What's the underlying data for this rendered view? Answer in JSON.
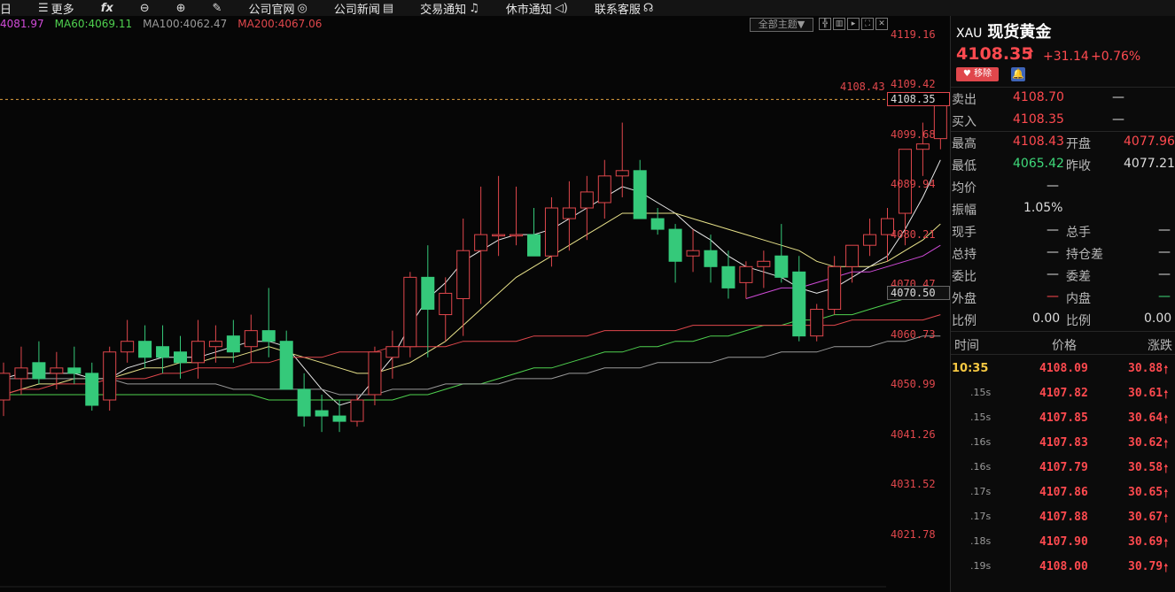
{
  "toolbar": {
    "items": [
      {
        "label": "日",
        "icon": ""
      },
      {
        "label": "更多",
        "icon": "menu-icon"
      },
      {
        "label": "",
        "icon": "fx-icon"
      },
      {
        "label": "",
        "icon": "zoom-out-icon"
      },
      {
        "label": "",
        "icon": "zoom-in-icon"
      },
      {
        "label": "",
        "icon": "draw-icon"
      },
      {
        "label": "公司官网",
        "icon": "globe-icon"
      },
      {
        "label": "公司新闻",
        "icon": "news-icon"
      },
      {
        "label": "交易通知",
        "icon": "bell-icon"
      },
      {
        "label": "休市通知",
        "icon": "speaker-icon"
      },
      {
        "label": "联系客服",
        "icon": "headset-icon"
      }
    ]
  },
  "ma_legend": [
    {
      "label": "4081.97",
      "color": "#d04bd8"
    },
    {
      "label": "MA60:4069.11",
      "color": "#4fd14f"
    },
    {
      "label": "MA100:4062.47",
      "color": "#9a9a9a"
    },
    {
      "label": "MA200:4067.06",
      "color": "#e0474c"
    }
  ],
  "theme_button": "全部主题▼",
  "axis": {
    "ticks": [
      "4119.16",
      "4109.42",
      "4099.68",
      "4089.94",
      "4080.21",
      "4070.47",
      "4060.73",
      "4050.99",
      "4041.26",
      "4031.52",
      "4021.78"
    ],
    "current_price": "4108.35",
    "aux_price": "4070.50",
    "high_label": "4108.43"
  },
  "chart_data": {
    "type": "candlestick",
    "ylim": [
      4016,
      4124
    ],
    "candles": [
      {
        "o": 4052,
        "h": 4059,
        "l": 4049,
        "c": 4057
      },
      {
        "o": 4056,
        "h": 4062,
        "l": 4053,
        "c": 4058
      },
      {
        "o": 4059,
        "h": 4063,
        "l": 4055,
        "c": 4056
      },
      {
        "o": 4057,
        "h": 4061,
        "l": 4054,
        "c": 4058
      },
      {
        "o": 4058,
        "h": 4062,
        "l": 4055,
        "c": 4057
      },
      {
        "o": 4057,
        "h": 4059,
        "l": 4050,
        "c": 4051
      },
      {
        "o": 4052,
        "h": 4062,
        "l": 4050,
        "c": 4061
      },
      {
        "o": 4061,
        "h": 4067,
        "l": 4059,
        "c": 4063
      },
      {
        "o": 4063,
        "h": 4066,
        "l": 4058,
        "c": 4060
      },
      {
        "o": 4062,
        "h": 4066,
        "l": 4057,
        "c": 4060
      },
      {
        "o": 4061,
        "h": 4064,
        "l": 4056,
        "c": 4059
      },
      {
        "o": 4059,
        "h": 4067,
        "l": 4056,
        "c": 4063
      },
      {
        "o": 4062,
        "h": 4066,
        "l": 4059,
        "c": 4063
      },
      {
        "o": 4064,
        "h": 4067,
        "l": 4059,
        "c": 4061
      },
      {
        "o": 4062,
        "h": 4068,
        "l": 4059,
        "c": 4065
      },
      {
        "o": 4065,
        "h": 4073,
        "l": 4060,
        "c": 4063
      },
      {
        "o": 4063,
        "h": 4065,
        "l": 4054,
        "c": 4054
      },
      {
        "o": 4054,
        "h": 4057,
        "l": 4047,
        "c": 4049
      },
      {
        "o": 4050,
        "h": 4053,
        "l": 4046,
        "c": 4049
      },
      {
        "o": 4049,
        "h": 4052,
        "l": 4046,
        "c": 4048
      },
      {
        "o": 4048,
        "h": 4053,
        "l": 4047,
        "c": 4052
      },
      {
        "o": 4053,
        "h": 4062,
        "l": 4051,
        "c": 4061
      },
      {
        "o": 4060,
        "h": 4065,
        "l": 4056,
        "c": 4062
      },
      {
        "o": 4062,
        "h": 4076,
        "l": 4060,
        "c": 4075
      },
      {
        "o": 4075,
        "h": 4081,
        "l": 4060,
        "c": 4069
      },
      {
        "o": 4068,
        "h": 4075,
        "l": 4063,
        "c": 4072
      },
      {
        "o": 4071,
        "h": 4086,
        "l": 4064,
        "c": 4080
      },
      {
        "o": 4080,
        "h": 4092,
        "l": 4070,
        "c": 4083
      },
      {
        "o": 4083,
        "h": 4094,
        "l": 4079,
        "c": 4083
      },
      {
        "o": 4083,
        "h": 4092,
        "l": 4081,
        "c": 4083
      },
      {
        "o": 4083,
        "h": 4088,
        "l": 4080,
        "c": 4079
      },
      {
        "o": 4079,
        "h": 4090,
        "l": 4077,
        "c": 4088
      },
      {
        "o": 4086,
        "h": 4093,
        "l": 4080,
        "c": 4088
      },
      {
        "o": 4088,
        "h": 4094,
        "l": 4082,
        "c": 4091
      },
      {
        "o": 4089,
        "h": 4097,
        "l": 4086,
        "c": 4094
      },
      {
        "o": 4094,
        "h": 4104,
        "l": 4090,
        "c": 4095
      },
      {
        "o": 4095,
        "h": 4097,
        "l": 4089,
        "c": 4086
      },
      {
        "o": 4086,
        "h": 4088,
        "l": 4083,
        "c": 4084
      },
      {
        "o": 4084,
        "h": 4085,
        "l": 4074,
        "c": 4078
      },
      {
        "o": 4079,
        "h": 4084,
        "l": 4076,
        "c": 4080
      },
      {
        "o": 4080,
        "h": 4083,
        "l": 4074,
        "c": 4077
      },
      {
        "o": 4077,
        "h": 4080,
        "l": 4071,
        "c": 4073
      },
      {
        "o": 4074,
        "h": 4078,
        "l": 4071,
        "c": 4077
      },
      {
        "o": 4077,
        "h": 4080,
        "l": 4073,
        "c": 4078
      },
      {
        "o": 4079,
        "h": 4085,
        "l": 4074,
        "c": 4075
      },
      {
        "o": 4076,
        "h": 4079,
        "l": 4063,
        "c": 4064
      },
      {
        "o": 4064,
        "h": 4070,
        "l": 4063,
        "c": 4069
      },
      {
        "o": 4069,
        "h": 4079,
        "l": 4068,
        "c": 4077
      },
      {
        "o": 4077,
        "h": 4081,
        "l": 4074,
        "c": 4081
      },
      {
        "o": 4081,
        "h": 4086,
        "l": 4079,
        "c": 4083
      },
      {
        "o": 4083,
        "h": 4088,
        "l": 4078,
        "c": 4086
      },
      {
        "o": 4087,
        "h": 4099,
        "l": 4081,
        "c": 4099
      },
      {
        "o": 4099,
        "h": 4104,
        "l": 4094,
        "c": 4100
      },
      {
        "o": 4101,
        "h": 4109,
        "l": 4099,
        "c": 4108
      }
    ],
    "ma_lines": [
      {
        "name": "MA-white",
        "color": "#e8e8e8",
        "values": [
          4056,
          4057,
          4057,
          4057,
          4057,
          4056,
          4056,
          4058,
          4059,
          4060,
          4060,
          4060,
          4061,
          4062,
          4063,
          4063,
          4062,
          4058,
          4054,
          4051,
          4052,
          4056,
          4060,
          4066,
          4071,
          4074,
          4078,
          4080,
          4082,
          4083,
          4083,
          4084,
          4086,
          4088,
          4090,
          4092,
          4091,
          4089,
          4087,
          4084,
          4082,
          4079,
          4077,
          4076,
          4075,
          4073,
          4072,
          4073,
          4075,
          4077,
          4079,
          4084,
          4090,
          4097
        ]
      },
      {
        "name": "MA-yellow",
        "color": "#e8e28a",
        "values": [
          4053,
          4054,
          4055,
          4055,
          4056,
          4056,
          4056,
          4057,
          4058,
          4058,
          4059,
          4059,
          4060,
          4060,
          4061,
          4062,
          4061,
          4060,
          4059,
          4058,
          4057,
          4057,
          4058,
          4059,
          4061,
          4063,
          4066,
          4069,
          4072,
          4075,
          4077,
          4079,
          4081,
          4083,
          4085,
          4087,
          4087,
          4087,
          4087,
          4086,
          4085,
          4084,
          4083,
          4082,
          4081,
          4080,
          4078,
          4077,
          4077,
          4077,
          4078,
          4080,
          4082,
          4085
        ]
      },
      {
        "name": "MA-magenta",
        "color": "#d04bd8",
        "values": [
          null,
          null,
          null,
          null,
          null,
          null,
          null,
          null,
          null,
          null,
          null,
          null,
          null,
          null,
          null,
          null,
          null,
          null,
          null,
          null,
          null,
          null,
          null,
          null,
          null,
          null,
          null,
          null,
          null,
          null,
          null,
          null,
          null,
          null,
          null,
          null,
          null,
          null,
          null,
          null,
          null,
          null,
          4071,
          4072,
          4073,
          4073,
          4074,
          4075,
          4076,
          4076,
          4077,
          4078,
          4079,
          4081
        ]
      },
      {
        "name": "MA60",
        "color": "#4fd14f",
        "values": [
          4053,
          4053,
          4053,
          4053,
          4053,
          4053,
          4053,
          4053,
          4053,
          4053,
          4053,
          4053,
          4053,
          4053,
          4053,
          4052,
          4052,
          4052,
          4052,
          4052,
          4052,
          4052,
          4052,
          4053,
          4053,
          4054,
          4055,
          4055,
          4056,
          4057,
          4058,
          4058,
          4059,
          4060,
          4061,
          4061,
          4062,
          4062,
          4063,
          4063,
          4064,
          4064,
          4065,
          4066,
          4066,
          4067,
          4067,
          4068,
          4068,
          4069,
          4070,
          4071,
          4072,
          4073
        ]
      },
      {
        "name": "MA100",
        "color": "#9a9a9a",
        "values": [
          4056,
          4056,
          4056,
          4056,
          4056,
          4056,
          4056,
          4055,
          4055,
          4055,
          4055,
          4055,
          4055,
          4054,
          4054,
          4054,
          4054,
          4054,
          4054,
          4053,
          4053,
          4053,
          4054,
          4054,
          4054,
          4055,
          4055,
          4055,
          4055,
          4056,
          4056,
          4056,
          4057,
          4057,
          4058,
          4058,
          4058,
          4059,
          4059,
          4059,
          4059,
          4060,
          4060,
          4060,
          4061,
          4061,
          4061,
          4062,
          4062,
          4062,
          4063,
          4063,
          4064,
          4064
        ]
      },
      {
        "name": "MA200",
        "color": "#e0474c",
        "values": [
          4053,
          4054,
          4054,
          4055,
          4055,
          4055,
          4056,
          4056,
          4056,
          4057,
          4057,
          4058,
          4058,
          4058,
          4059,
          4059,
          4060,
          4060,
          4060,
          4061,
          4061,
          4061,
          4062,
          4062,
          4062,
          4062,
          4063,
          4063,
          4063,
          4063,
          4064,
          4064,
          4064,
          4064,
          4065,
          4065,
          4065,
          4065,
          4065,
          4066,
          4066,
          4066,
          4066,
          4066,
          4066,
          4066,
          4066,
          4066,
          4067,
          4067,
          4067,
          4067,
          4067,
          4068
        ]
      }
    ]
  },
  "quote": {
    "code": "XAU",
    "name": "现货黄金",
    "last": "4108.35",
    "change": "+31.14",
    "change_pct": "+0.76%",
    "remove_label": "移除",
    "sell_label": "卖出",
    "sell": "4108.70",
    "sell_vol": "—",
    "buy_label": "买入",
    "buy": "4108.35",
    "buy_vol": "—",
    "high_label": "最高",
    "high": "4108.43",
    "open_label": "开盘",
    "open": "4077.96",
    "low_label": "最低",
    "low": "4065.42",
    "prev_label": "昨收",
    "prev": "4077.21",
    "avg_label": "均价",
    "avg": "—",
    "amp_label": "振幅",
    "amp": "1.05%",
    "now_hand_label": "现手",
    "now_hand": "—",
    "total_hand_label": "总手",
    "total_hand": "—",
    "total_hold_label": "总持",
    "total_hold": "—",
    "hold_diff_label": "持仓差",
    "hold_diff": "—",
    "bid_ratio_label": "委比",
    "bid_ratio": "—",
    "bid_diff_label": "委差",
    "bid_diff": "—",
    "outer_label": "外盘",
    "outer": "—",
    "inner_label": "内盘",
    "inner": "—",
    "ratio1_label": "比例",
    "ratio1": "0.00",
    "ratio2_label": "比例",
    "ratio2": "0.00"
  },
  "ticks": {
    "headers": [
      "时间",
      "价格",
      "涨跌"
    ],
    "rows": [
      {
        "time": "10:35",
        "price": "4108.09",
        "chg": "30.88"
      },
      {
        "time": ".15s",
        "price": "4107.82",
        "chg": "30.61"
      },
      {
        "time": ".15s",
        "price": "4107.85",
        "chg": "30.64"
      },
      {
        "time": ".16s",
        "price": "4107.83",
        "chg": "30.62"
      },
      {
        "time": ".16s",
        "price": "4107.79",
        "chg": "30.58"
      },
      {
        "time": ".17s",
        "price": "4107.86",
        "chg": "30.65"
      },
      {
        "time": ".17s",
        "price": "4107.88",
        "chg": "30.67"
      },
      {
        "time": ".18s",
        "price": "4107.90",
        "chg": "30.69"
      },
      {
        "time": ".19s",
        "price": "4108.00",
        "chg": "30.79"
      }
    ]
  }
}
